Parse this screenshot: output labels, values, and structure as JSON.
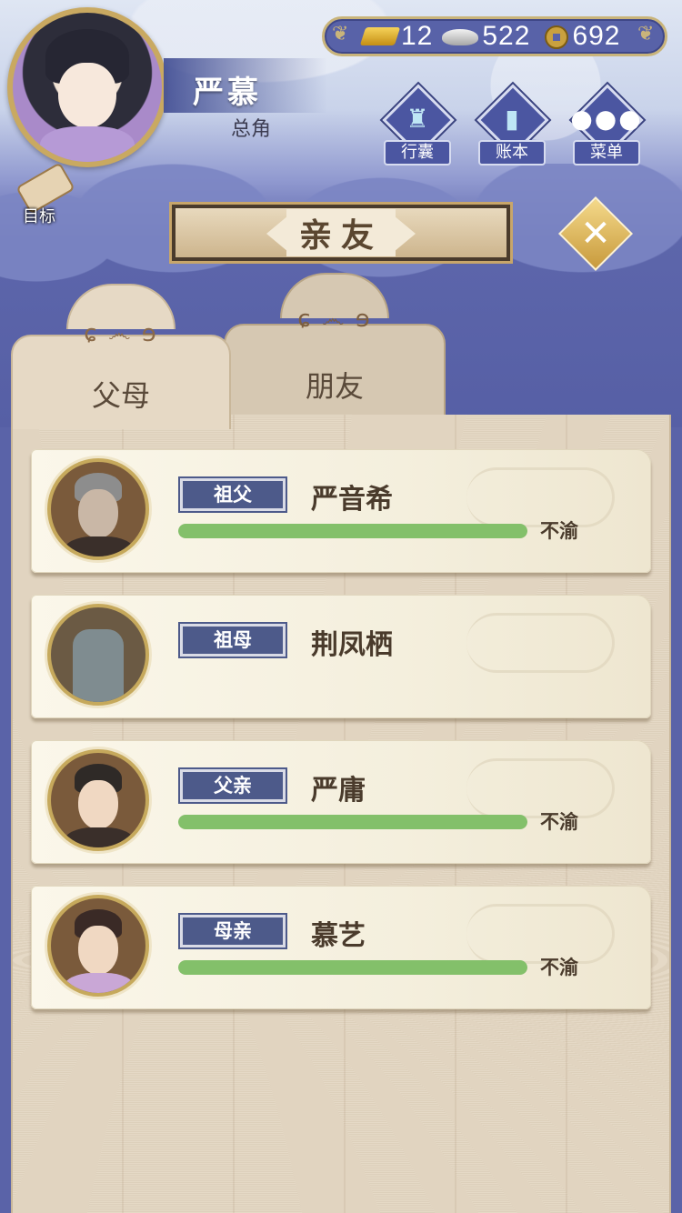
{
  "header": {
    "player_name": "严慕",
    "player_title": "总角",
    "goal_label": "目标"
  },
  "currency": {
    "gold": "12",
    "silver": "522",
    "copper": "692"
  },
  "menu": {
    "bag": "行囊",
    "ledger": "账本",
    "menu": "菜单"
  },
  "panel": {
    "title": "亲友",
    "close_glyph": "✕",
    "tabs": [
      {
        "label": "父母",
        "active": true
      },
      {
        "label": "朋友",
        "active": false
      }
    ]
  },
  "relatives": [
    {
      "relation": "祖父",
      "name": "严音希",
      "mood": "不渝",
      "affinity": 1.0,
      "has_bar": true
    },
    {
      "relation": "祖母",
      "name": "荆凤栖",
      "mood": "",
      "affinity": null,
      "has_bar": false
    },
    {
      "relation": "父亲",
      "name": "严庸",
      "mood": "不渝",
      "affinity": 1.0,
      "has_bar": true
    },
    {
      "relation": "母亲",
      "name": "慕艺",
      "mood": "不渝",
      "affinity": 1.0,
      "has_bar": true
    }
  ],
  "colors": {
    "affinity_bar": "#83c06a",
    "relation_badge": "#4d5a8a",
    "sky": "#5a63a8"
  },
  "icons": {
    "bag": "bag-icon",
    "ledger": "ledger-icon",
    "menu": "more-dots-icon",
    "goal": "scroll-icon",
    "close": "close-icon"
  }
}
